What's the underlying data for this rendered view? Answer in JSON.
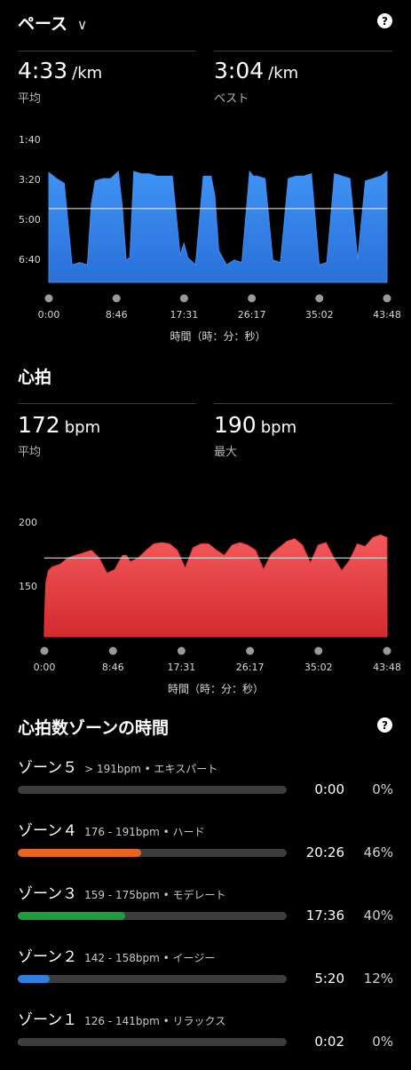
{
  "pace": {
    "title": "ペース",
    "avg_value": "4:33",
    "avg_unit": "/km",
    "avg_label": "平均",
    "best_value": "3:04",
    "best_unit": "/km",
    "best_label": "ベスト"
  },
  "heart": {
    "title": "心拍",
    "avg_value": "172",
    "avg_unit": "bpm",
    "avg_label": "平均",
    "max_value": "190",
    "max_unit": "bpm",
    "max_label": "最大"
  },
  "zones_section": {
    "title": "心拍数ゾーンの時間",
    "zones": [
      {
        "name": "ゾーン５",
        "range": "> 191bpm • エキスパート",
        "time": "0:00",
        "percent": "0%",
        "fraction": 0.0,
        "color": "#4a4a4a"
      },
      {
        "name": "ゾーン４",
        "range": "176 - 191bpm • ハード",
        "time": "20:26",
        "percent": "46%",
        "fraction": 0.46,
        "color": "#e8641f"
      },
      {
        "name": "ゾーン３",
        "range": "159 - 175bpm • モデレート",
        "time": "17:36",
        "percent": "40%",
        "fraction": 0.4,
        "color": "#1f9d3c"
      },
      {
        "name": "ゾーン２",
        "range": "142 - 158bpm • イージー",
        "time": "5:20",
        "percent": "12%",
        "fraction": 0.12,
        "color": "#2f7fe0"
      },
      {
        "name": "ゾーン１",
        "range": "126 - 141bpm • リラックス",
        "time": "0:02",
        "percent": "0%",
        "fraction": 0.005,
        "color": "#4a4a4a"
      }
    ]
  },
  "icons": {
    "dropdown": "chevron-down-icon",
    "help": "question-circle-icon"
  },
  "help_glyph": "?",
  "dropdown_glyph": "∨",
  "chart_data": [
    {
      "type": "area",
      "x": [
        "0:00",
        "1:00",
        "1:30",
        "2:00",
        "3:00",
        "4:00",
        "5:00",
        "5:30",
        "6:00",
        "7:00",
        "8:00",
        "9:00",
        "9:30",
        "10:00",
        "10:30",
        "11:00",
        "12:00",
        "13:00",
        "14:00",
        "15:00",
        "16:00",
        "17:00",
        "17:30",
        "18:00",
        "19:00",
        "20:00",
        "21:00",
        "21:30",
        "22:00",
        "23:00",
        "24:00",
        "25:00",
        "26:00",
        "26:30",
        "27:00",
        "28:00",
        "29:00",
        "30:00",
        "31:00",
        "32:00",
        "33:00",
        "34:00",
        "35:00",
        "36:00",
        "37:00",
        "38:00",
        "39:00",
        "40:00",
        "41:00",
        "42:00",
        "43:00",
        "43:48"
      ],
      "values": [
        3.05,
        3.3,
        3.4,
        3.5,
        6.9,
        6.8,
        6.9,
        4.4,
        3.4,
        3.3,
        3.3,
        3.0,
        4.4,
        6.7,
        6.6,
        3.0,
        3.1,
        3.1,
        3.2,
        3.2,
        3.2,
        6.5,
        6.0,
        6.6,
        6.9,
        3.2,
        3.2,
        4.0,
        6.3,
        6.9,
        6.7,
        6.8,
        3.0,
        3.2,
        3.2,
        3.3,
        6.7,
        6.8,
        3.3,
        3.2,
        3.2,
        3.1,
        6.9,
        6.8,
        3.1,
        3.2,
        3.3,
        6.7,
        3.4,
        3.3,
        3.2,
        3.0
      ],
      "xtick_labels": [
        "0:00",
        "8:46",
        "17:31",
        "26:17",
        "35:02",
        "43:48"
      ],
      "ytick_labels": [
        "1:40",
        "3:20",
        "5:00",
        "6:40"
      ],
      "avg_line": "4:33",
      "xlabel": "時間（時：分：秒）",
      "color": "#3a8ef0"
    },
    {
      "type": "area",
      "x": [
        "0:00",
        "0:10",
        "0:30",
        "1:00",
        "2:00",
        "3:00",
        "4:00",
        "5:00",
        "6:00",
        "7:00",
        "8:00",
        "9:00",
        "10:00",
        "10:30",
        "11:00",
        "12:00",
        "13:00",
        "14:00",
        "15:00",
        "16:00",
        "17:00",
        "18:00",
        "19:00",
        "20:00",
        "21:00",
        "22:00",
        "23:00",
        "24:00",
        "25:00",
        "26:00",
        "27:00",
        "28:00",
        "29:00",
        "30:00",
        "31:00",
        "32:00",
        "33:00",
        "34:00",
        "35:00",
        "36:00",
        "37:00",
        "38:00",
        "39:00",
        "40:00",
        "41:00",
        "42:00",
        "43:00",
        "43:48"
      ],
      "values": [
        118,
        152,
        162,
        165,
        167,
        172,
        174,
        176,
        178,
        172,
        160,
        163,
        174,
        174,
        169,
        172,
        178,
        183,
        184,
        183,
        178,
        164,
        180,
        183,
        183,
        178,
        174,
        182,
        184,
        182,
        178,
        163,
        175,
        180,
        185,
        187,
        182,
        168,
        182,
        184,
        172,
        162,
        170,
        183,
        181,
        188,
        190,
        188
      ],
      "xtick_labels": [
        "0:00",
        "8:46",
        "17:31",
        "26:17",
        "35:02",
        "43:48"
      ],
      "ytick_labels": [
        "200",
        "150"
      ],
      "ylim": [
        115,
        200
      ],
      "avg_line": "172",
      "xlabel": "時間（時：分：秒）",
      "color": "#e8363a"
    }
  ]
}
